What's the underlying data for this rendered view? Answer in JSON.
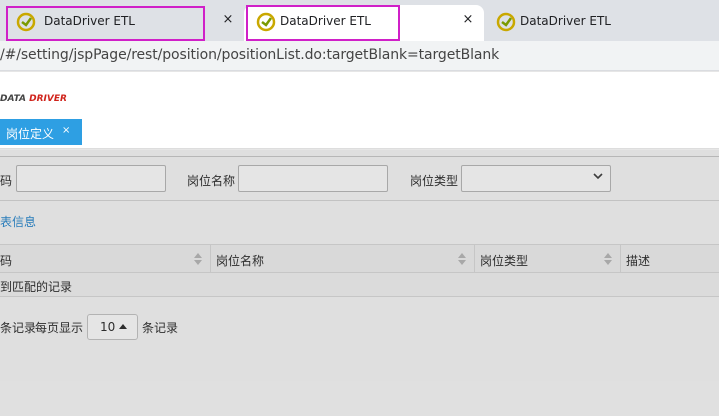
{
  "browser": {
    "tabs": [
      {
        "title": "DataDriver ETL",
        "active": false,
        "highlighted": true
      },
      {
        "title": "DataDriver ETL",
        "active": true,
        "highlighted": true
      },
      {
        "title": "DataDriver ETL",
        "active": false,
        "highlighted": false
      }
    ],
    "close_glyph": "×",
    "url": "/#/setting/jspPage/rest/position/positionList.do:targetBlank=targetBlank"
  },
  "app": {
    "logo_part1": "DATA ",
    "logo_part2": "DRIVER",
    "open_tab": {
      "label": "岗位定义",
      "close": "×"
    }
  },
  "filter": {
    "code_label": "码",
    "name_label": "岗位名称",
    "type_label": "岗位类型",
    "code_value": "",
    "name_value": "",
    "type_value": ""
  },
  "section_title": "表信息",
  "table": {
    "columns": [
      "码",
      "岗位名称",
      "岗位类型",
      "描述"
    ],
    "empty_text": "到匹配的记录"
  },
  "pager": {
    "records_suffix": "条记录",
    "per_page_label": "每页显示",
    "page_size": "10",
    "records_suffix2": "条记录"
  },
  "colors": {
    "highlight": "#d020c8",
    "accent": "#2e9fe3"
  }
}
